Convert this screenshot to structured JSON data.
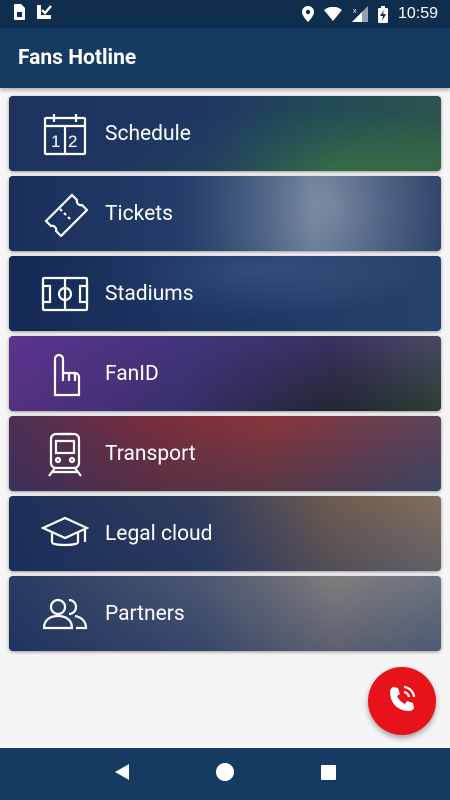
{
  "status_bar": {
    "time": "10:59",
    "icons": [
      "sim-card-icon",
      "download-check-icon",
      "location-icon",
      "wifi-icon",
      "signal-icon",
      "battery-charging-icon"
    ]
  },
  "app_bar": {
    "title": "Fans Hotline"
  },
  "menu": {
    "items": [
      {
        "label": "Schedule",
        "icon": "calendar-icon"
      },
      {
        "label": "Tickets",
        "icon": "ticket-icon"
      },
      {
        "label": "Stadiums",
        "icon": "stadium-field-icon"
      },
      {
        "label": "FanID",
        "icon": "foam-finger-icon"
      },
      {
        "label": "Transport",
        "icon": "train-icon"
      },
      {
        "label": "Legal cloud",
        "icon": "graduation-cap-icon"
      },
      {
        "label": "Partners",
        "icon": "people-icon"
      }
    ]
  },
  "fab": {
    "icon": "phone-ringing-icon",
    "color": "#e8121a"
  },
  "nav_bar": {
    "buttons": [
      "back-icon",
      "home-icon",
      "recents-icon"
    ]
  },
  "colors": {
    "primary": "#163b63",
    "status_bar": "#0f2e4e",
    "accent": "#e8121a"
  }
}
